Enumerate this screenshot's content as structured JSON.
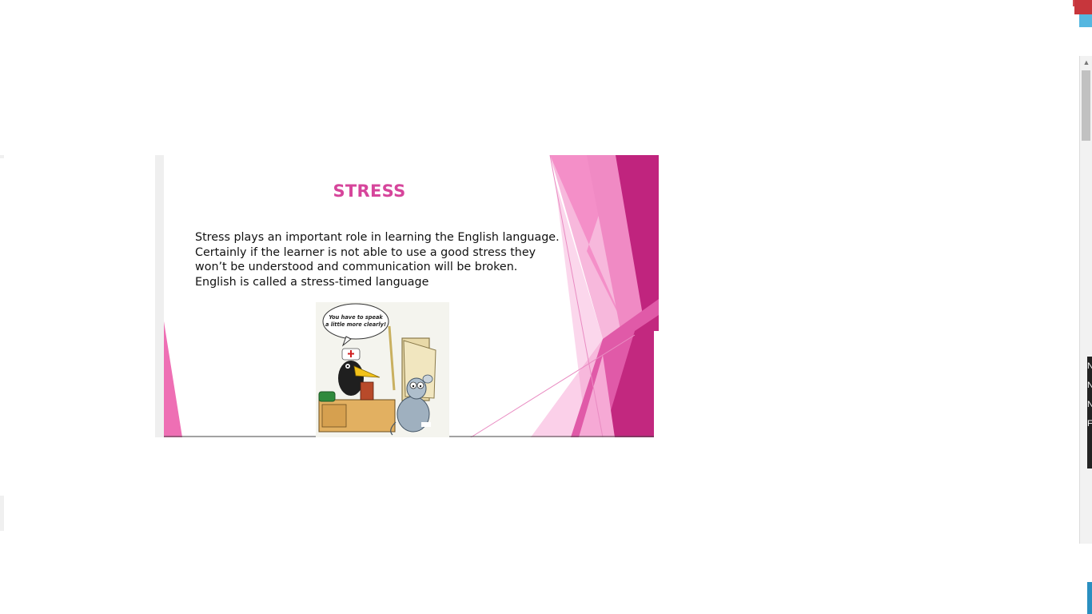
{
  "slide": {
    "title": "STRESS",
    "body_lines": [
      "Stress plays an important role in learning the English language.",
      "Certainly if the learner is not able to use a good stress they",
      "won’t be understood and communication will be broken.",
      "English is called a stress-timed language"
    ],
    "cartoon": {
      "speech_line1": "You have to speak",
      "speech_line2": "a little more clearly!"
    },
    "accent_colors": [
      "#d6459b",
      "#f08ac4",
      "#c0247e",
      "#f7b8dc"
    ]
  },
  "window_edge": {
    "scroll_up_icon": "▲",
    "dark_strip_letters": [
      "N",
      "N",
      "N",
      "F"
    ]
  }
}
